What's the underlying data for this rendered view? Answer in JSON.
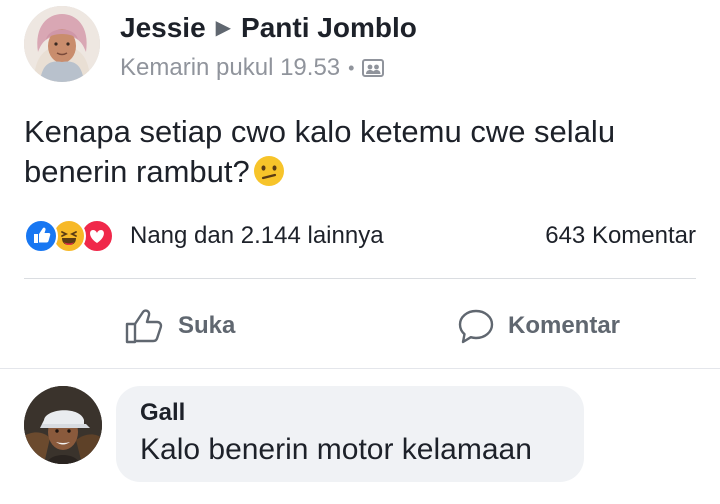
{
  "post": {
    "author": "Jessie",
    "group": "Panti Jomblo",
    "timestamp": "Kemarin pukul 19.53",
    "separator": "•",
    "audience_icon": "group-audience-icon",
    "text": "Kenapa setiap cwo kalo ketemu cwe selalu benerin rambut?",
    "text_emoji": "confused-face-emoji"
  },
  "reactions": {
    "icons": [
      "like-reaction-icon",
      "haha-reaction-icon",
      "love-reaction-icon"
    ],
    "summary": "Nang dan 2.144 lainnya",
    "comments_count": "643 Komentar"
  },
  "actions": {
    "like_label": "Suka",
    "comment_label": "Komentar"
  },
  "comment": {
    "author": "Gall",
    "text": "Kalo benerin motor kelamaan"
  },
  "colors": {
    "primary_text": "#1d2129",
    "secondary_text": "#90949c",
    "action_text": "#606770",
    "like_blue": "#1877f2",
    "love_red": "#f0284a",
    "haha_yellow": "#f7b928",
    "bubble_bg": "#f0f2f5"
  }
}
